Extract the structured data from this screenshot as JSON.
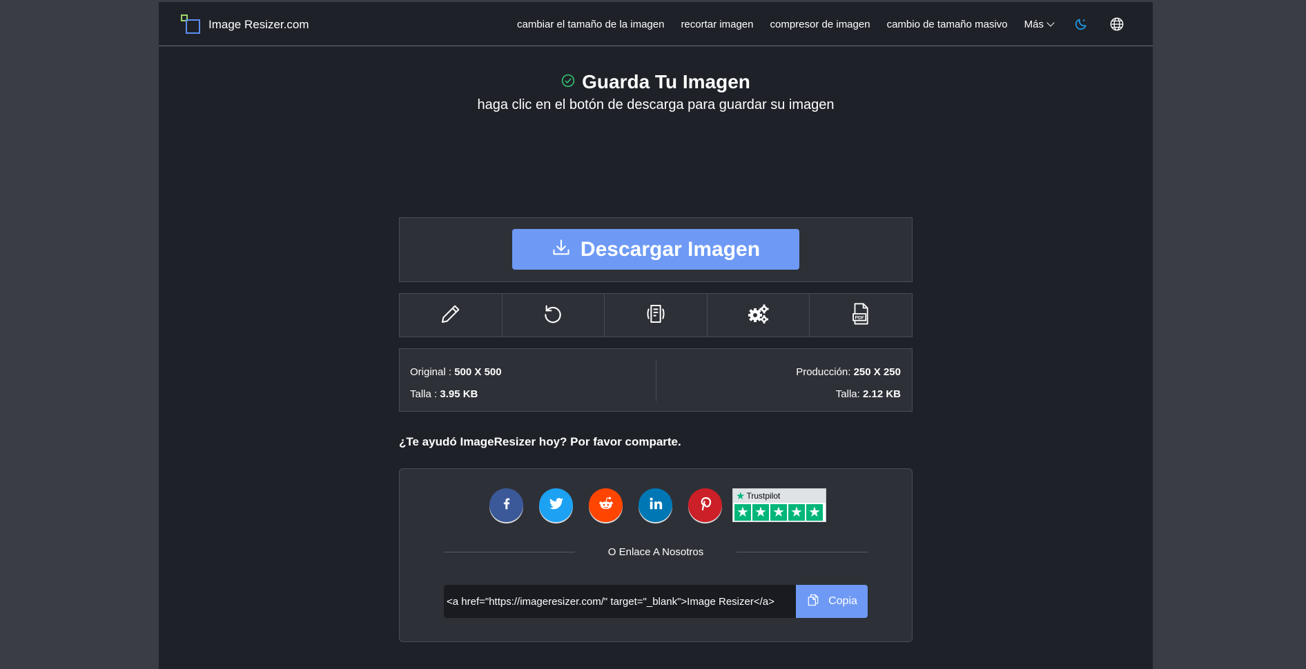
{
  "header": {
    "logo_text": "Image Resizer.com",
    "nav": [
      {
        "label": "cambiar el tamaño de la imagen"
      },
      {
        "label": "recortar imagen"
      },
      {
        "label": "compresor de imagen"
      },
      {
        "label": "cambio de tamaño masivo"
      }
    ],
    "more_label": "Más",
    "icons": [
      "dark-mode-icon",
      "language-globe-icon"
    ]
  },
  "main": {
    "title": "Guarda Tu Imagen",
    "subtitle": "haga clic en el botón de descarga para guardar su imagen",
    "download_label": "Descargar Imagen",
    "tools": [
      "edit-pencil-icon",
      "undo-icon",
      "summary-icon",
      "settings-gears-icon",
      "pdf-icon"
    ]
  },
  "info": {
    "original_label": "Original :",
    "original_value": "500 X 500",
    "size_label": "Talla :",
    "size_value": "3.95 KB",
    "output_label": "Producción:",
    "output_value": "250 X 250",
    "output_size_label": "Talla:",
    "output_size_value": "2.12 KB"
  },
  "share": {
    "question": "¿Te ayudó ImageResizer hoy? Por favor comparte.",
    "networks": [
      "facebook",
      "twitter",
      "reddit",
      "linkedin",
      "pinterest"
    ],
    "trustpilot_label": "Trustpilot",
    "or_text": "O Enlace A Nosotros",
    "link_code": "<a href=\"https://imageresizer.com/\" target=\"_blank\">Image Resizer</a>",
    "copy_label": "Copia"
  },
  "colors": {
    "accent": "#6e9af5",
    "success": "#2fbf71",
    "facebook": "#3b5998",
    "twitter": "#1da1f2",
    "reddit": "#ff4500",
    "linkedin": "#0077b5",
    "pinterest": "#cb2027",
    "trustpilot": "#00b67a"
  }
}
